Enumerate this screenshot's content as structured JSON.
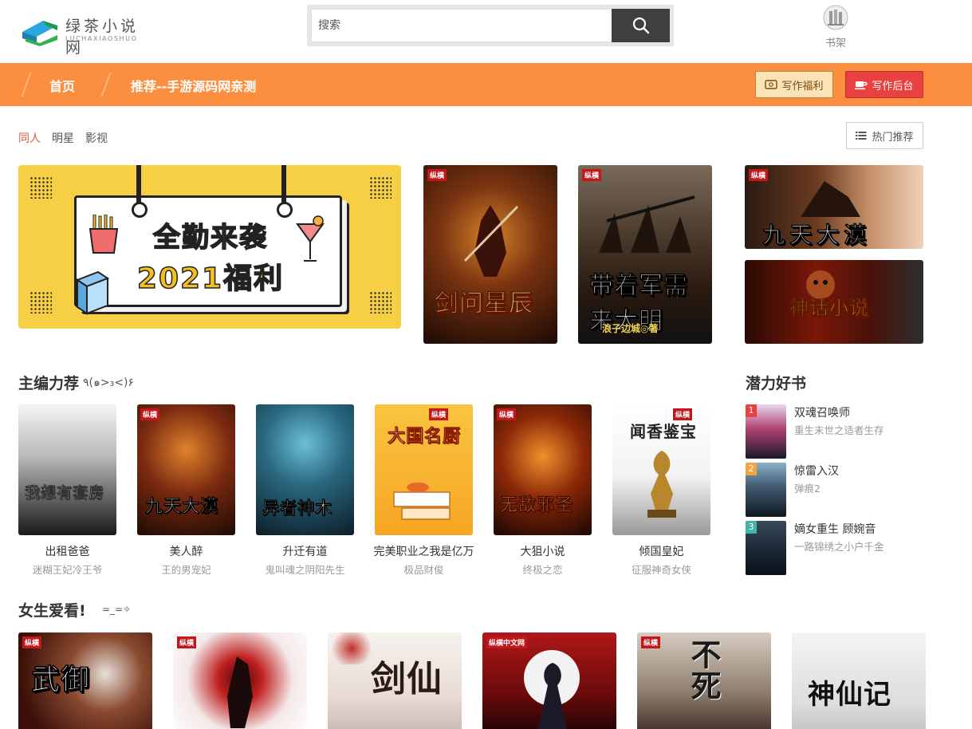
{
  "header": {
    "logo_title": "绿茶小说网",
    "logo_sub": "LUCHAXIAOSHUO",
    "search_placeholder": "搜索",
    "shelf_label": "书架"
  },
  "nav": {
    "items": [
      "首页",
      "推荐--手游源码网亲测"
    ],
    "welfare_label": "写作福利",
    "backend_label": "写作后台"
  },
  "categories": [
    "同人",
    "明星",
    "影视"
  ],
  "hot_label": "热门推荐",
  "banner": {
    "line1": "全勤来袭",
    "line2": "2021福利"
  },
  "featured": [
    {
      "title": "剑问星辰"
    },
    {
      "title": "带着军需来大明",
      "author_line": "浪子边城◎著"
    },
    {
      "title": "九天大漠"
    },
    {
      "title": "神话小说"
    }
  ],
  "section1": {
    "title": "主编力荐",
    "emoji": "٩(๑>₃<)۶",
    "books": [
      {
        "name": "出租爸爸",
        "author": "迷糊王妃冷王爷",
        "cover_text": "我想有套房"
      },
      {
        "name": "美人醉",
        "author": "王的男宠妃",
        "cover_text": "九天大漠"
      },
      {
        "name": "升迁有道",
        "author": "鬼叫魂之阴阳先生",
        "cover_text": "异者神木"
      },
      {
        "name": "完美职业之我是亿万",
        "author": "极品财俊",
        "cover_text": "大国名厨"
      },
      {
        "name": "大狙小说",
        "author": "终极之恋",
        "cover_text": "无敌邪圣"
      },
      {
        "name": "倾国皇妃",
        "author": "征服神奇女侠",
        "cover_text": "闻香鉴宝"
      }
    ]
  },
  "potential": {
    "title": "潜力好书",
    "items": [
      {
        "rank": "1",
        "title": "双魂召唤师",
        "author": "重生末世之适者生存"
      },
      {
        "rank": "2",
        "title": "惊雷入汉",
        "author": "弹痕2"
      },
      {
        "rank": "3",
        "title": "嫡女重生 顾婉音",
        "author": "一路锦绣之小户千金"
      }
    ]
  },
  "section2": {
    "title": "女生爱看!",
    "emoji": "=_=✧",
    "covers": [
      "武御",
      "",
      "剑仙",
      "",
      "不死",
      "神仙记"
    ]
  },
  "colors": {
    "nav_bg": "#fb8f3f",
    "accent_red": "#e8413f",
    "banner_yellow": "#f6cf45"
  }
}
